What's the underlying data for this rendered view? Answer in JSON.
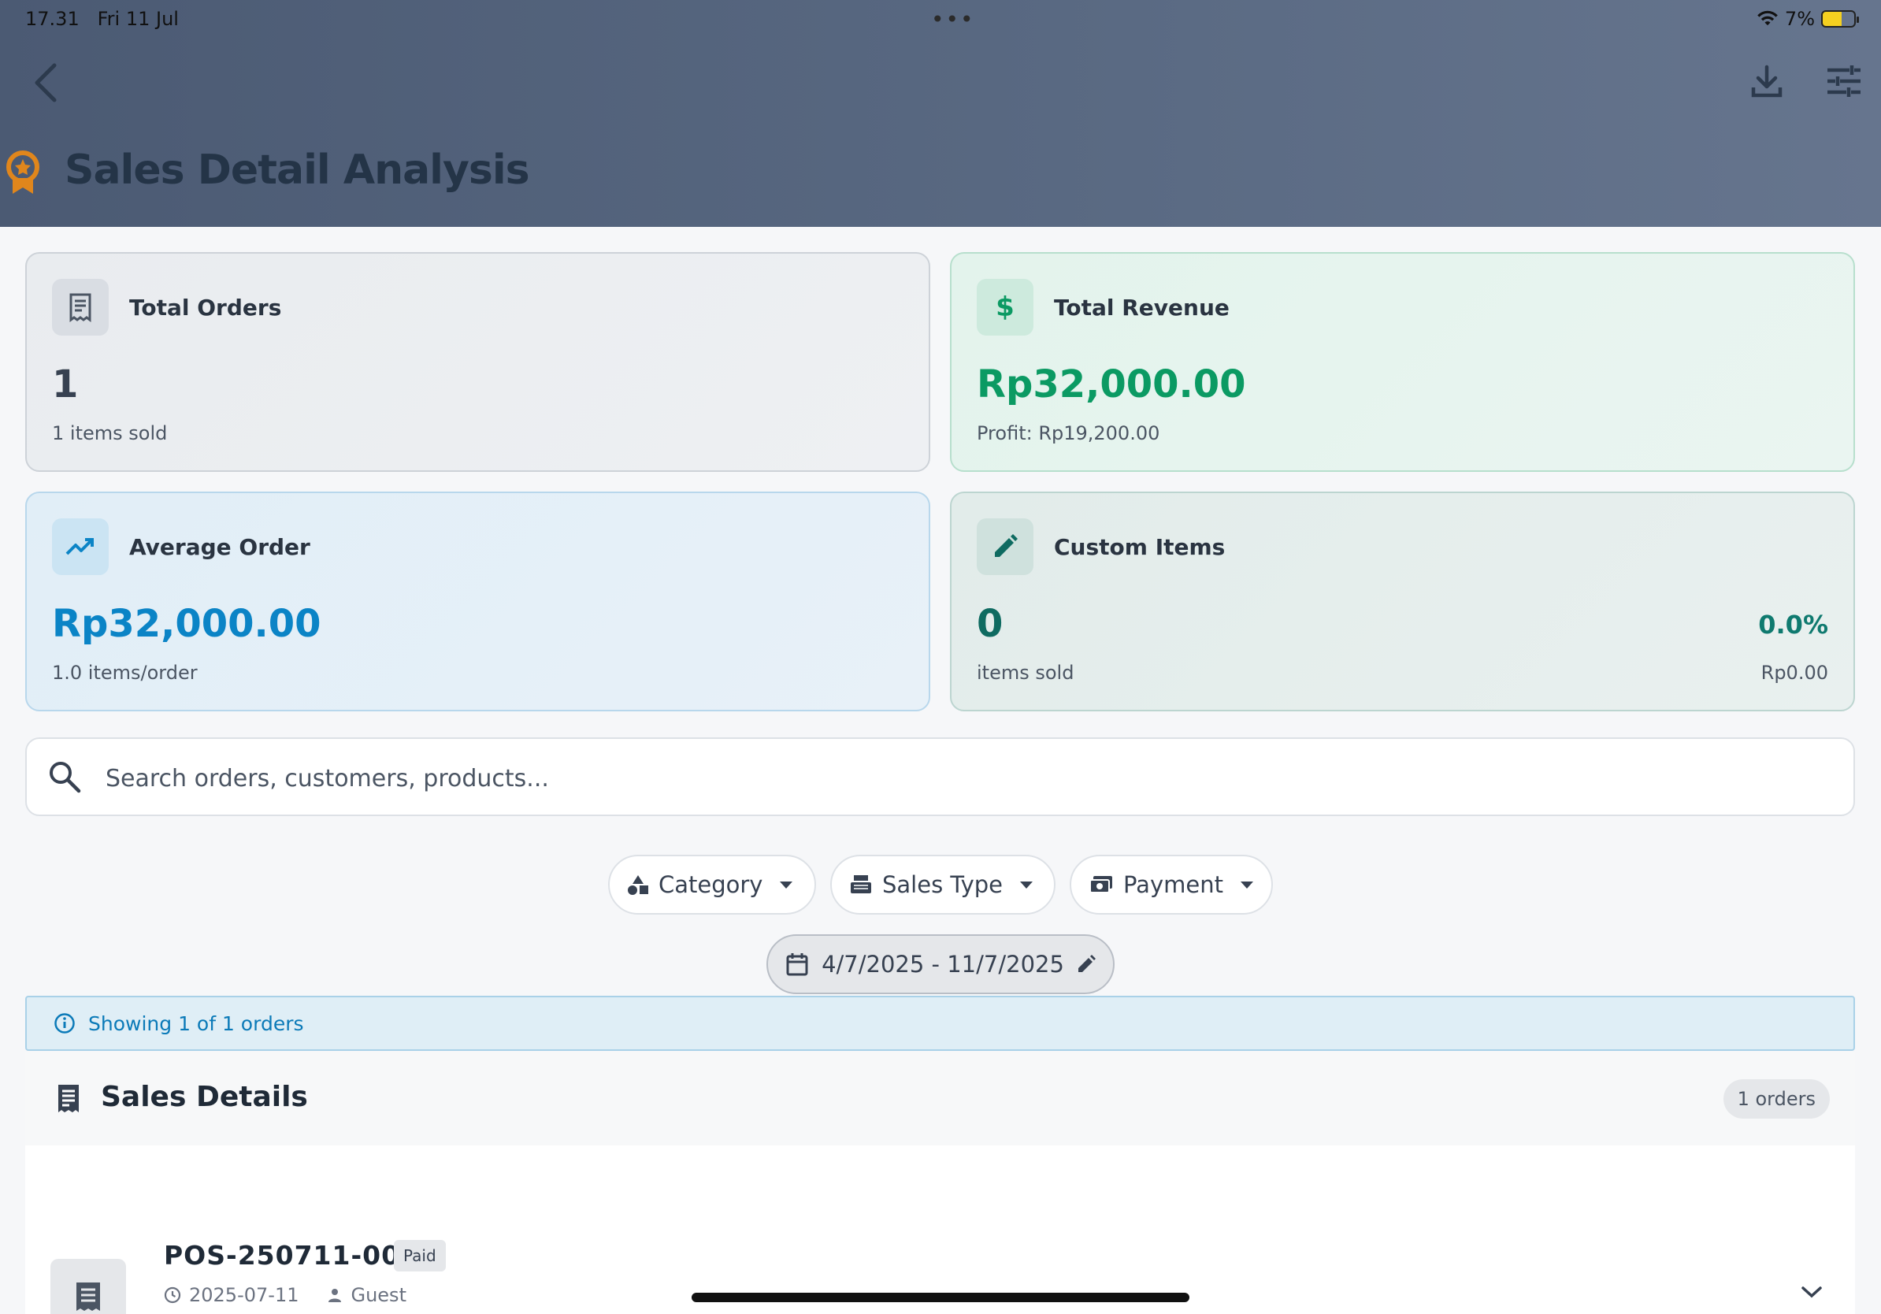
{
  "status": {
    "time": "17.31",
    "date": "Fri 11 Jul",
    "battery": "7%"
  },
  "header": {
    "title": "Sales Detail Analysis"
  },
  "cards": {
    "total_orders": {
      "title": "Total Orders",
      "value": "1",
      "sub": "1 items sold"
    },
    "total_revenue": {
      "title": "Total Revenue",
      "value": "Rp32,000.00",
      "sub": "Profit: Rp19,200.00"
    },
    "average_order": {
      "title": "Average Order",
      "value": "Rp32,000.00",
      "sub": "1.0 items/order"
    },
    "custom_items": {
      "title": "Custom Items",
      "value": "0",
      "sub": "items sold",
      "percent": "0.0%",
      "amount": "Rp0.00"
    }
  },
  "search": {
    "placeholder": "Search orders, customers, products..."
  },
  "filters": {
    "category": "Category",
    "sales_type": "Sales Type",
    "payment": "Payment"
  },
  "date_range": "4/7/2025 - 11/7/2025",
  "info": "Showing 1 of 1 orders",
  "section": {
    "title": "Sales Details",
    "count": "1 orders"
  },
  "orders": [
    {
      "id": "POS-250711-001",
      "status": "Paid",
      "date": "2025-07-11",
      "customer": "Guest"
    }
  ],
  "colors": {
    "revenue": "#0b9a63",
    "average": "#0b84c6",
    "custom": "#0f6b61",
    "accent_badge": "#e0861c"
  }
}
